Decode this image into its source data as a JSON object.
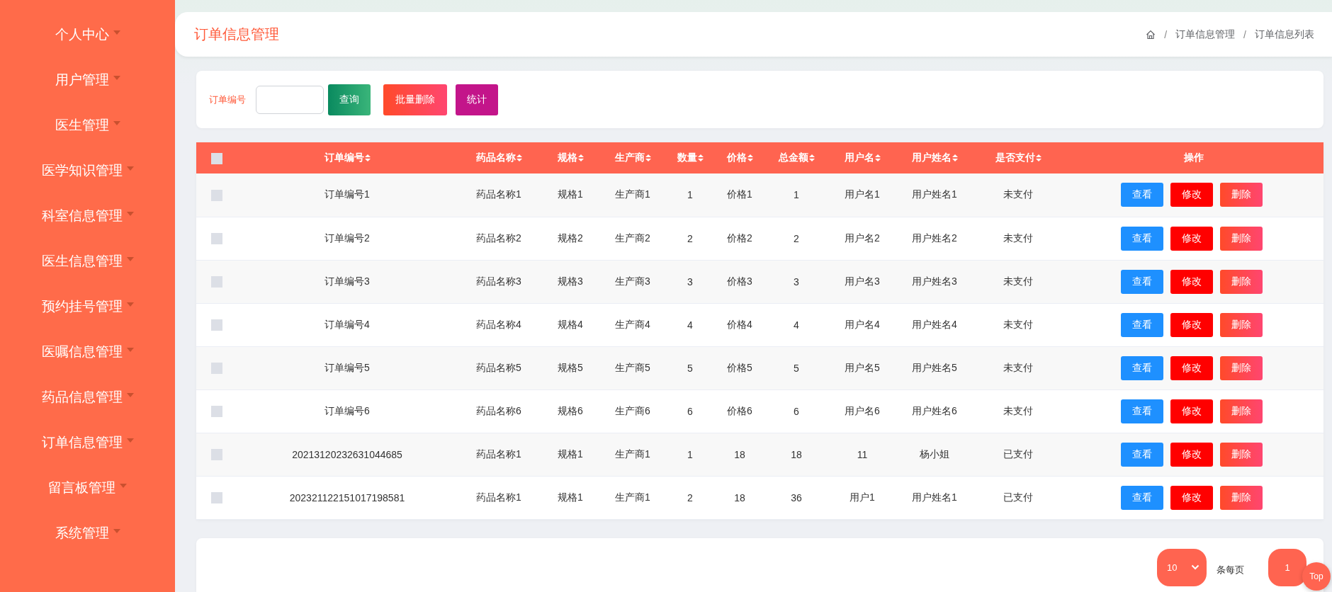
{
  "sidebar": {
    "items": [
      {
        "label": "个人中心",
        "expanded": false
      },
      {
        "label": "用户管理",
        "expanded": false
      },
      {
        "label": "医生管理",
        "expanded": false
      },
      {
        "label": "医学知识管理",
        "expanded": false
      },
      {
        "label": "科室信息管理",
        "expanded": false
      },
      {
        "label": "医生信息管理",
        "expanded": false
      },
      {
        "label": "预约挂号管理",
        "expanded": false
      },
      {
        "label": "医嘱信息管理",
        "expanded": false
      },
      {
        "label": "药品信息管理",
        "expanded": false
      },
      {
        "label": "订单信息管理",
        "expanded": false
      },
      {
        "label": "留言板管理",
        "expanded": false
      },
      {
        "label": "系统管理",
        "expanded": false
      }
    ]
  },
  "header": {
    "title": "订单信息管理",
    "breadcrumb": [
      {
        "separator": "/",
        "label": "订单信息管理"
      },
      {
        "separator": "/",
        "label": "订单信息列表"
      }
    ]
  },
  "search": {
    "label": "订单编号",
    "buttons": [
      {
        "label": "查询",
        "kind": "search"
      },
      {
        "label": "批量删除",
        "kind": "delete"
      },
      {
        "label": "统计",
        "kind": "stats"
      }
    ]
  },
  "table": {
    "select_all": {
      "checked": false
    },
    "columns": [
      {
        "label": "订单编号",
        "sortable": true
      },
      {
        "label": "药品名称",
        "sortable": true
      },
      {
        "label": "规格",
        "sortable": true
      },
      {
        "label": "生产商",
        "sortable": true
      },
      {
        "label": "数量",
        "sortable": true
      },
      {
        "label": "价格",
        "sortable": true
      },
      {
        "label": "总金额",
        "sortable": true
      },
      {
        "label": "用户名",
        "sortable": true
      },
      {
        "label": "用户姓名",
        "sortable": true
      },
      {
        "label": "是否支付",
        "sortable": true
      },
      {
        "label": "操作",
        "sortable": false
      }
    ],
    "rows": [
      {
        "checked": false,
        "cells": [
          "订单编号1",
          "药品名称1",
          "规格1",
          "生产商1",
          "1",
          "价格1",
          "1",
          "用户名1",
          "用户姓名1",
          "未支付"
        ],
        "actions": [
          {
            "label": "查看",
            "kind": "view"
          },
          {
            "label": "修改",
            "kind": "edit"
          },
          {
            "label": "删除",
            "kind": "delete"
          }
        ]
      },
      {
        "checked": false,
        "cells": [
          "订单编号2",
          "药品名称2",
          "规格2",
          "生产商2",
          "2",
          "价格2",
          "2",
          "用户名2",
          "用户姓名2",
          "未支付"
        ],
        "actions": [
          {
            "label": "查看",
            "kind": "view"
          },
          {
            "label": "修改",
            "kind": "edit"
          },
          {
            "label": "删除",
            "kind": "delete"
          }
        ]
      },
      {
        "checked": false,
        "cells": [
          "订单编号3",
          "药品名称3",
          "规格3",
          "生产商3",
          "3",
          "价格3",
          "3",
          "用户名3",
          "用户姓名3",
          "未支付"
        ],
        "actions": [
          {
            "label": "查看",
            "kind": "view"
          },
          {
            "label": "修改",
            "kind": "edit"
          },
          {
            "label": "删除",
            "kind": "delete"
          }
        ]
      },
      {
        "checked": false,
        "cells": [
          "订单编号4",
          "药品名称4",
          "规格4",
          "生产商4",
          "4",
          "价格4",
          "4",
          "用户名4",
          "用户姓名4",
          "未支付"
        ],
        "actions": [
          {
            "label": "查看",
            "kind": "view"
          },
          {
            "label": "修改",
            "kind": "edit"
          },
          {
            "label": "删除",
            "kind": "delete"
          }
        ]
      },
      {
        "checked": false,
        "cells": [
          "订单编号5",
          "药品名称5",
          "规格5",
          "生产商5",
          "5",
          "价格5",
          "5",
          "用户名5",
          "用户姓名5",
          "未支付"
        ],
        "actions": [
          {
            "label": "查看",
            "kind": "view"
          },
          {
            "label": "修改",
            "kind": "edit"
          },
          {
            "label": "删除",
            "kind": "delete"
          }
        ]
      },
      {
        "checked": false,
        "cells": [
          "订单编号6",
          "药品名称6",
          "规格6",
          "生产商6",
          "6",
          "价格6",
          "6",
          "用户名6",
          "用户姓名6",
          "未支付"
        ],
        "actions": [
          {
            "label": "查看",
            "kind": "view"
          },
          {
            "label": "修改",
            "kind": "edit"
          },
          {
            "label": "删除",
            "kind": "delete"
          }
        ]
      },
      {
        "checked": false,
        "cells": [
          "20213120232631044685",
          "药品名称1",
          "规格1",
          "生产商1",
          "1",
          "18",
          "18",
          "11",
          "杨小姐",
          "已支付"
        ],
        "actions": [
          {
            "label": "查看",
            "kind": "view"
          },
          {
            "label": "修改",
            "kind": "edit"
          },
          {
            "label": "删除",
            "kind": "delete"
          }
        ]
      },
      {
        "checked": false,
        "cells": [
          "202321122151017198581",
          "药品名称1",
          "规格1",
          "生产商1",
          "2",
          "18",
          "36",
          "用户1",
          "用户姓名1",
          "已支付"
        ],
        "actions": [
          {
            "label": "查看",
            "kind": "view"
          },
          {
            "label": "修改",
            "kind": "edit"
          },
          {
            "label": "删除",
            "kind": "delete"
          }
        ]
      }
    ]
  },
  "pagination": {
    "page_size": "10",
    "page_size_label": "条每页",
    "pages": [
      {
        "label": "1",
        "selected": true
      }
    ]
  },
  "back_to_top": "Top"
}
